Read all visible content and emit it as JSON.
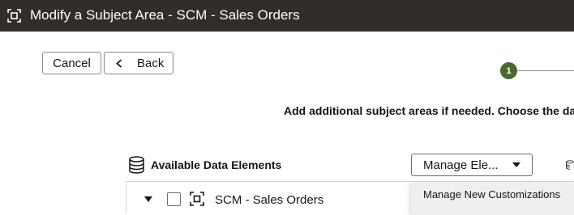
{
  "header": {
    "title": "Modify a Subject Area - SCM - Sales Orders",
    "icon": "subject-area-icon",
    "background": "#312d2a"
  },
  "toolbar": {
    "cancel_label": "Cancel",
    "back_label": "Back"
  },
  "train": {
    "current_step": "1",
    "accent": "#4a6a2b"
  },
  "instruction": "Add additional subject areas if needed. Choose the da",
  "available": {
    "title": "Available Data Elements",
    "icon": "database-icon"
  },
  "manage_select": {
    "value": "Manage Ele...",
    "options": [
      "Manage New Customizations"
    ]
  },
  "tree": {
    "items": [
      {
        "label": "SCM - Sales Orders",
        "icon": "subject-area-icon",
        "expanded": true,
        "checked": false
      }
    ]
  }
}
